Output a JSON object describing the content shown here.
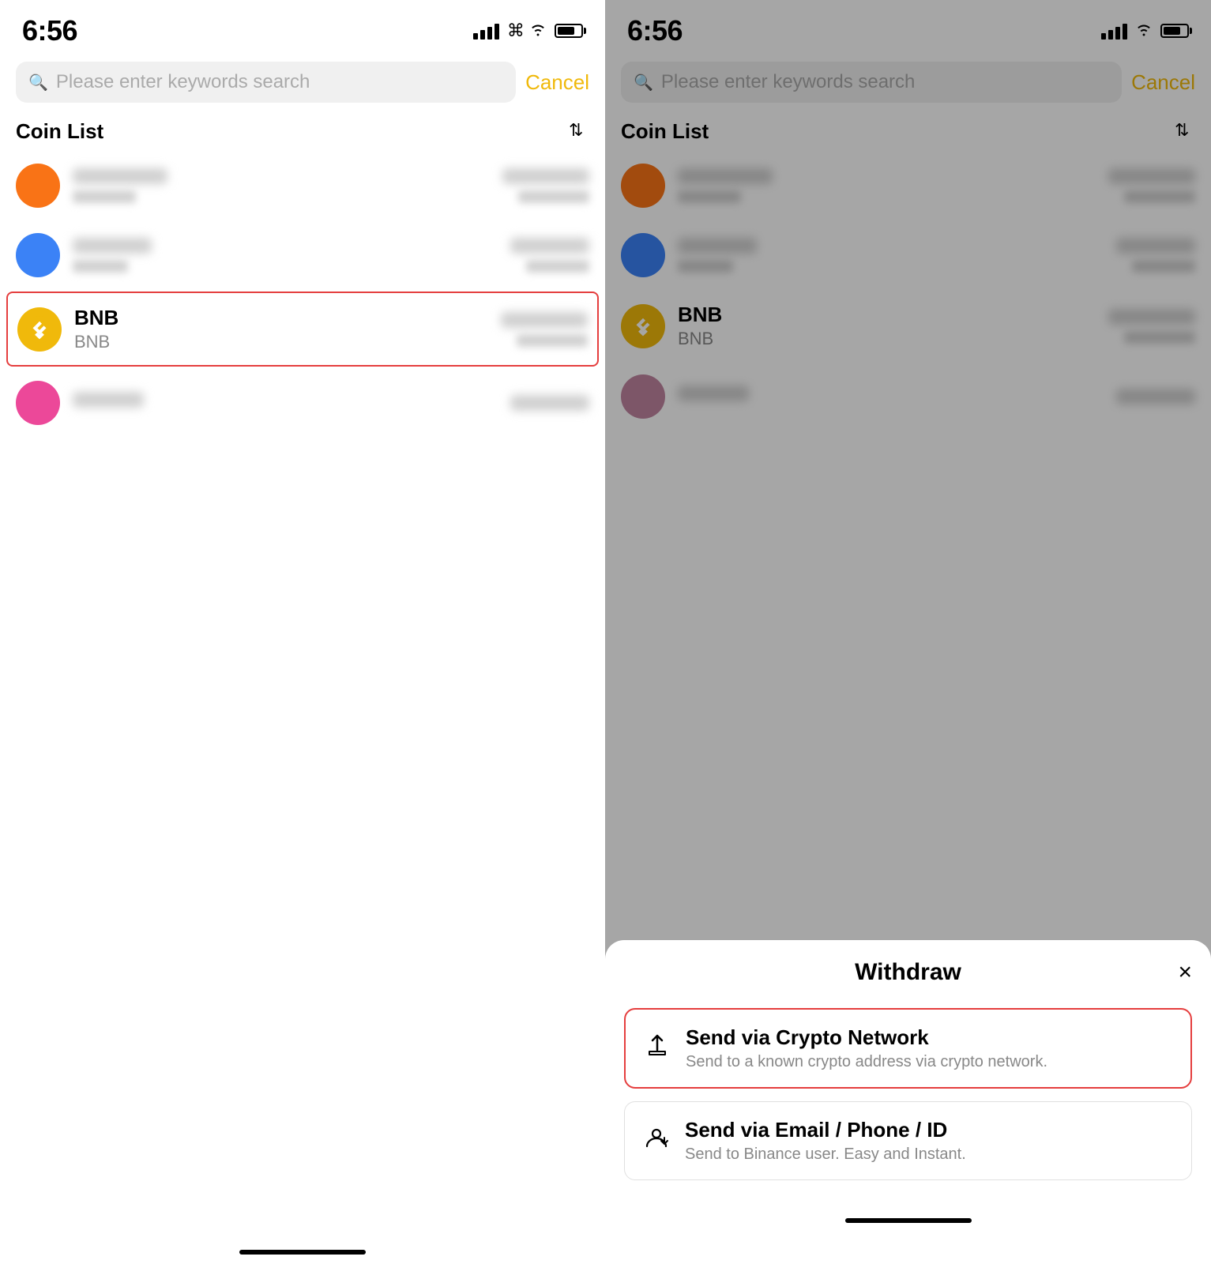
{
  "left": {
    "statusBar": {
      "time": "6:56"
    },
    "search": {
      "placeholder": "Please enter keywords search",
      "cancelLabel": "Cancel"
    },
    "coinList": {
      "title": "Coin List",
      "items": [
        {
          "id": "coin-1",
          "iconType": "orange",
          "name": "",
          "ticker": "",
          "highlighted": false,
          "blurred": true
        },
        {
          "id": "coin-2",
          "iconType": "blue",
          "name": "",
          "ticker": "",
          "highlighted": false,
          "blurred": true
        },
        {
          "id": "bnb",
          "iconType": "bnb",
          "name": "BNB",
          "ticker": "BNB",
          "highlighted": true,
          "blurred": false
        },
        {
          "id": "coin-4",
          "iconType": "pink",
          "name": "",
          "ticker": "",
          "highlighted": false,
          "blurred": true
        }
      ]
    }
  },
  "right": {
    "statusBar": {
      "time": "6:56"
    },
    "search": {
      "placeholder": "Please enter keywords search",
      "cancelLabel": "Cancel"
    },
    "coinList": {
      "title": "Coin List"
    },
    "modal": {
      "title": "Withdraw",
      "closeLabel": "×",
      "options": [
        {
          "id": "crypto-network",
          "title": "Send via Crypto Network",
          "description": "Send to a known crypto address via crypto network.",
          "highlighted": true
        },
        {
          "id": "email-phone",
          "title": "Send via Email / Phone / ID",
          "description": "Send to Binance user. Easy and Instant.",
          "highlighted": false
        }
      ]
    }
  }
}
